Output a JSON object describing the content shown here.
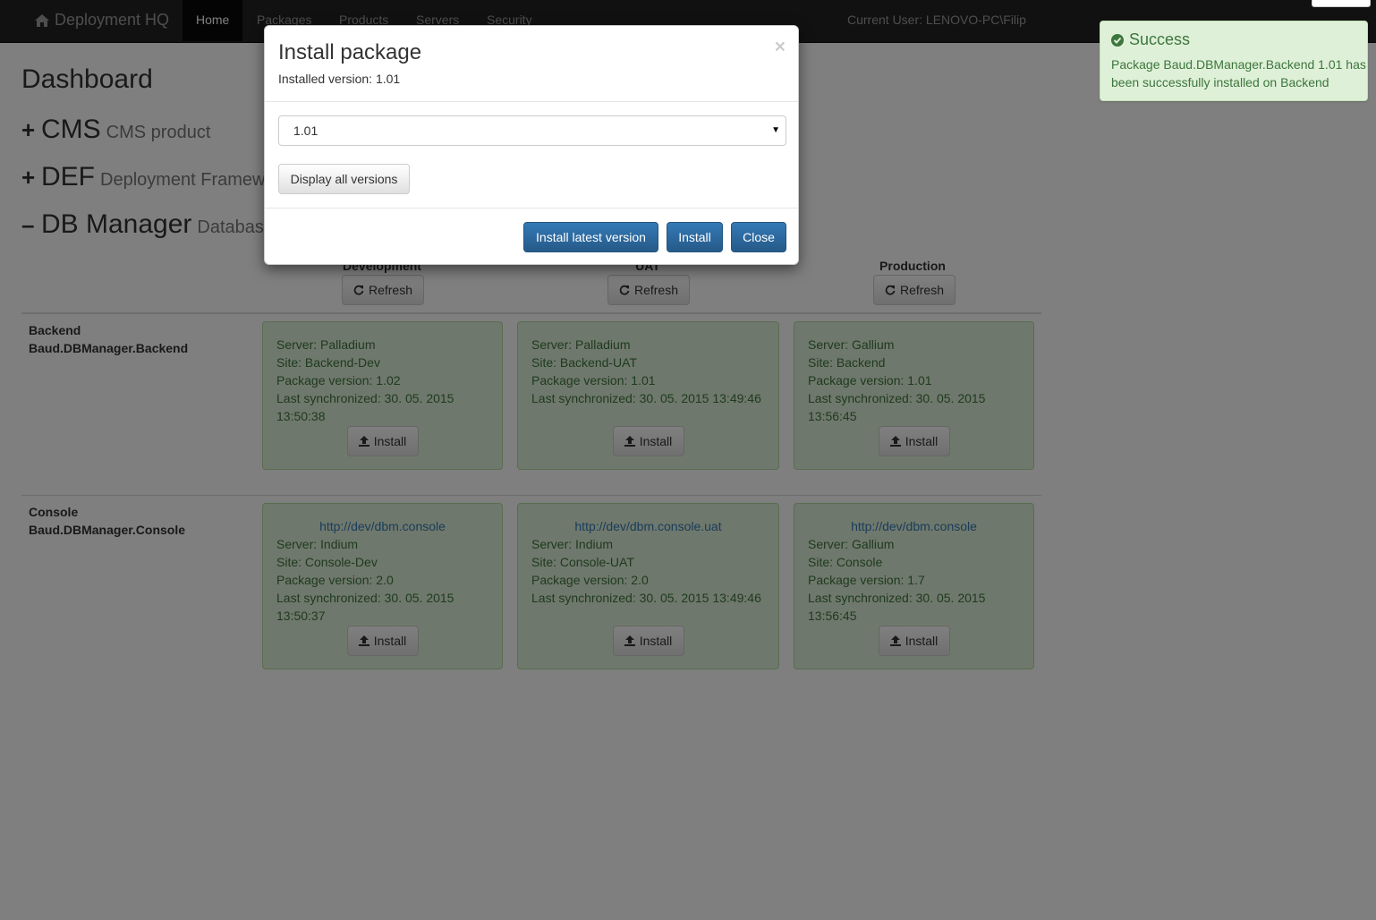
{
  "navbar": {
    "brand": "Deployment HQ",
    "items": [
      "Home",
      "Packages",
      "Products",
      "Servers",
      "Security"
    ],
    "current_user": "Current User: LENOVO-PC\\Filip"
  },
  "page": {
    "title": "Dashboard",
    "products": [
      {
        "toggle": "+",
        "name": "CMS",
        "description": "CMS product"
      },
      {
        "toggle": "+",
        "name": "DEF",
        "description": "Deployment Framework"
      },
      {
        "toggle": "–",
        "name": "DB Manager",
        "description": "Database Manager"
      }
    ]
  },
  "environments": [
    {
      "name": "Development",
      "refresh": "Refresh"
    },
    {
      "name": "UAT",
      "refresh": "Refresh"
    },
    {
      "name": "Production",
      "refresh": "Refresh"
    }
  ],
  "rows": [
    {
      "name": "Backend",
      "package": "Baud.DBManager.Backend",
      "cards": [
        {
          "link": "",
          "server": "Server: Palladium",
          "site": "Site: Backend-Dev",
          "version": "Package version: 1.02",
          "sync": "Last synchronized: 30. 05. 2015 13:50:38",
          "install": "Install"
        },
        {
          "link": "",
          "server": "Server: Palladium",
          "site": "Site: Backend-UAT",
          "version": "Package version: 1.01",
          "sync": "Last synchronized: 30. 05. 2015 13:49:46",
          "install": "Install"
        },
        {
          "link": "",
          "server": "Server: Gallium",
          "site": "Site: Backend",
          "version": "Package version: 1.01",
          "sync": "Last synchronized: 30. 05. 2015 13:56:45",
          "install": "Install"
        }
      ]
    },
    {
      "name": "Console",
      "package": "Baud.DBManager.Console",
      "cards": [
        {
          "link": "http://dev/dbm.console",
          "server": "Server: Indium",
          "site": "Site: Console-Dev",
          "version": "Package version: 2.0",
          "sync": "Last synchronized: 30. 05. 2015 13:50:37",
          "install": "Install"
        },
        {
          "link": "http://dev/dbm.console.uat",
          "server": "Server: Indium",
          "site": "Site: Console-UAT",
          "version": "Package version: 2.0",
          "sync": "Last synchronized: 30. 05. 2015 13:49:46",
          "install": "Install"
        },
        {
          "link": "http://dev/dbm.console",
          "server": "Server: Gallium",
          "site": "Site: Console",
          "version": "Package version: 1.7",
          "sync": "Last synchronized: 30. 05. 2015 13:56:45",
          "install": "Install"
        }
      ]
    }
  ],
  "modal": {
    "title": "Install package",
    "installed_version": "Installed version: 1.01",
    "close_symbol": "×",
    "selected_version": "1.01",
    "display_all": "Display all versions",
    "install_latest": "Install latest version",
    "install": "Install",
    "close": "Close"
  },
  "toast": {
    "title": "Success",
    "message": "Package Baud.DBManager.Backend 1.01 has been successfully installed on Backend"
  },
  "colors": {
    "navbar": "#222222",
    "card_bg": "#dff0d8",
    "card_text": "#3c763d",
    "primary": "#337ab7"
  }
}
